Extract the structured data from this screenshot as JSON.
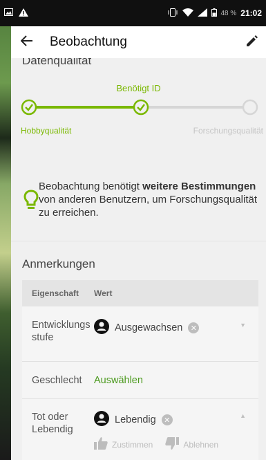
{
  "status_bar": {
    "battery_percent": "48 %",
    "time": "21:02",
    "icons": [
      "image-icon",
      "warning-icon",
      "vibrate-icon",
      "wifi-icon",
      "signal-icon",
      "battery-icon"
    ]
  },
  "app_bar": {
    "title": "Beobachtung",
    "back_icon": "arrow-left-icon",
    "edit_icon": "pencil-icon"
  },
  "data_quality": {
    "section_title": "Datenqualität",
    "current_level": "Benötigt ID",
    "left_level": "Hobbyqualität",
    "right_level": "Forschungsqualität",
    "steps_completed": 2,
    "steps_total": 3
  },
  "notice": {
    "icon": "lightbulb-icon",
    "text_before": "Beobachtung benötigt ",
    "text_bold": "weitere Bestimmungen",
    "text_after": " von anderen Benutzern, um Forschungsqualität zu erreichen."
  },
  "annotations": {
    "section_title": "Anmerkungen",
    "col_property": "Eigenschaft",
    "col_value": "Wert",
    "rows": [
      {
        "property": "Entwicklungsstufe",
        "value": "Ausgewachsen"
      },
      {
        "property": "Geschlecht",
        "value": "Auswählen"
      },
      {
        "property": "Tot oder Lebendig",
        "value": "Lebendig",
        "agree": "Zustimmen",
        "disagree": "Ablehnen"
      }
    ]
  },
  "colors": {
    "accent": "#7ab800",
    "link": "#4c9a1f",
    "muted": "#c5c5c5"
  }
}
